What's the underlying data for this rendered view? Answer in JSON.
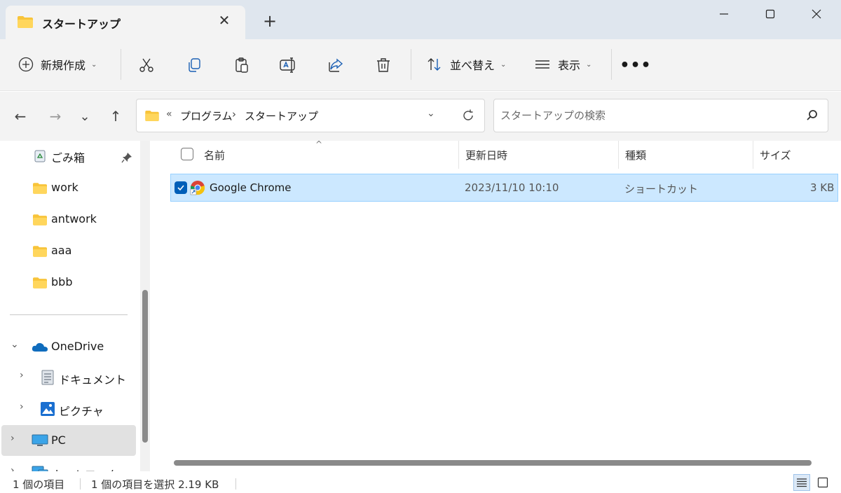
{
  "window": {
    "tab_title": "スタートアップ",
    "tab_close": "✕",
    "new_tab": "+",
    "minimize_icon": "minimize-icon",
    "maximize_icon": "maximize-icon",
    "close_icon": "close-icon"
  },
  "toolbar": {
    "new_label": "新規作成",
    "sort_label": "並べ替え",
    "view_label": "表示",
    "more_label": "•••",
    "icons": [
      "cut-icon",
      "copy-icon",
      "paste-icon",
      "rename-icon",
      "share-icon",
      "delete-icon"
    ]
  },
  "nav": {
    "back": "←",
    "forward": "→",
    "recent": "⌄",
    "up": "↑",
    "overflow": "«",
    "breadcrumbs": [
      "プログラム",
      "スタートアップ"
    ],
    "crumb_separator": "›",
    "search_placeholder": "スタートアップの検索"
  },
  "sidebar": {
    "quick": [
      {
        "label": "ごみ箱",
        "icon": "recycle-bin-icon"
      },
      {
        "label": "work",
        "icon": "folder-icon"
      },
      {
        "label": "antwork",
        "icon": "folder-icon"
      },
      {
        "label": "aaa",
        "icon": "folder-icon"
      },
      {
        "label": "bbb",
        "icon": "folder-icon"
      }
    ],
    "tree": [
      {
        "label": "OneDrive",
        "icon": "onedrive-icon",
        "expander": "⌄"
      },
      {
        "label": "ドキュメント",
        "icon": "documents-icon",
        "expander": "›"
      },
      {
        "label": "ピクチャ",
        "icon": "pictures-icon",
        "expander": "›"
      },
      {
        "label": "PC",
        "icon": "pc-icon",
        "expander": "›"
      },
      {
        "label": "ネットワーク",
        "icon": "network-icon",
        "expander": "›"
      }
    ]
  },
  "file_list": {
    "sort_indicator": "^",
    "columns": [
      "名前",
      "更新日時",
      "種類",
      "サイズ"
    ],
    "rows": [
      {
        "name": "Google Chrome",
        "modified": "2023/11/10 10:10",
        "type": "ショートカット",
        "size": "3 KB",
        "selected": true
      }
    ]
  },
  "status": {
    "item_count": "1 個の項目",
    "selection": "1 個の項目を選択  2.19 KB"
  },
  "colors": {
    "accent": "#005fb8",
    "selection_bg": "#cce8ff",
    "folder": "#f8c43a"
  }
}
